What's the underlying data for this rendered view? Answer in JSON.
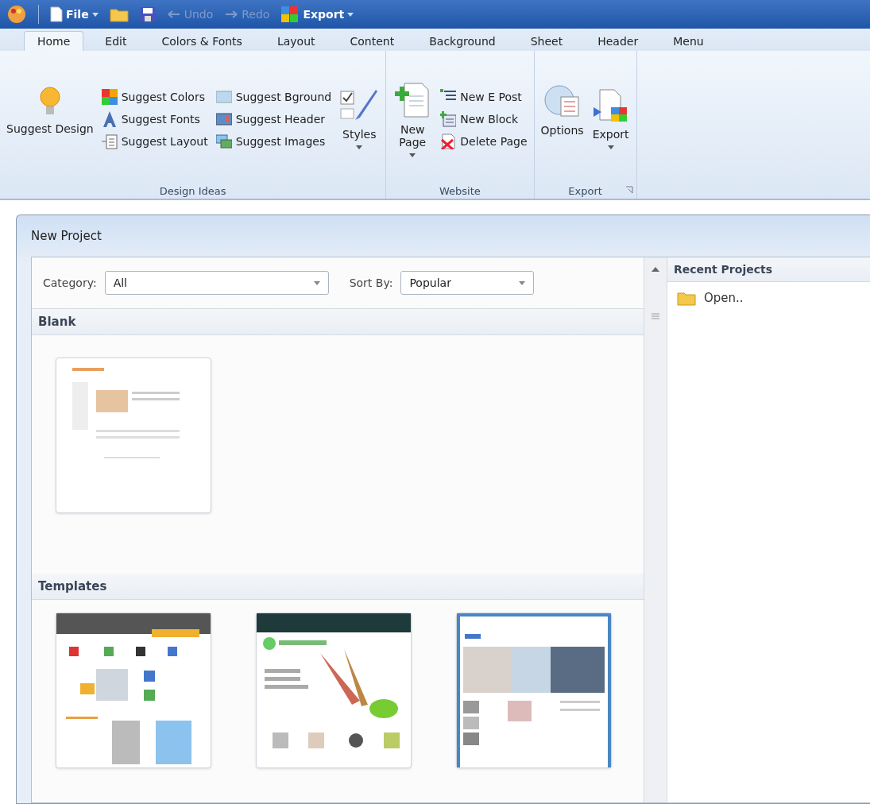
{
  "quick_access": [
    {
      "kind": "file",
      "label": "File",
      "disabled": false,
      "dropdown": true
    },
    {
      "kind": "open"
    },
    {
      "kind": "save"
    },
    {
      "kind": "undo",
      "label": "Undo",
      "disabled": true,
      "dropdown": false
    },
    {
      "kind": "redo",
      "label": "Redo",
      "disabled": true,
      "dropdown": false
    },
    {
      "kind": "export",
      "label": "Export",
      "disabled": false,
      "dropdown": true
    }
  ],
  "tabs": [
    {
      "label": "Home",
      "selected": true
    },
    {
      "label": "Edit",
      "selected": false
    },
    {
      "label": "Colors & Fonts",
      "selected": false
    },
    {
      "label": "Layout",
      "selected": false
    },
    {
      "label": "Content",
      "selected": false
    },
    {
      "label": "Background",
      "selected": false
    },
    {
      "label": "Sheet",
      "selected": false
    },
    {
      "label": "Header",
      "selected": false
    },
    {
      "label": "Menu",
      "selected": false
    }
  ],
  "ribbon_groups": [
    {
      "title": "Design Ideas",
      "launcher": false,
      "parts": [
        {
          "kind": "large",
          "label": "Suggest Design",
          "dropdown": false
        },
        {
          "kind": "stack",
          "items": [
            "Suggest Colors",
            "Suggest Fonts",
            "Suggest Layout"
          ]
        },
        {
          "kind": "stack",
          "items": [
            "Suggest Bground",
            "Suggest Header",
            "Suggest Images"
          ]
        },
        {
          "kind": "large",
          "label": "Styles",
          "dropdown": true
        }
      ]
    },
    {
      "title": "Website",
      "launcher": false,
      "parts": [
        {
          "kind": "large",
          "label": "New Page",
          "dropdown": true
        },
        {
          "kind": "stack",
          "items": [
            "New E Post",
            "New Block",
            "Delete Page"
          ]
        }
      ]
    },
    {
      "title": "Export",
      "launcher": true,
      "parts": [
        {
          "kind": "large",
          "label": "Options",
          "dropdown": false
        },
        {
          "kind": "large",
          "label": "Export",
          "dropdown": true
        }
      ]
    }
  ],
  "dialog": {
    "title": "New Project",
    "category": {
      "label": "Category:",
      "value": "All"
    },
    "sort": {
      "label": "Sort By:",
      "value": "Popular"
    },
    "sections": [
      {
        "title": "Blank",
        "templates": [
          {
            "kind": "blank"
          }
        ]
      },
      {
        "title": "Templates",
        "templates": [
          {
            "kind": "cubes"
          },
          {
            "kind": "nature"
          },
          {
            "kind": "business"
          }
        ]
      }
    ],
    "recent": {
      "title": "Recent Projects",
      "items": [
        {
          "label": "Open.."
        }
      ]
    }
  }
}
